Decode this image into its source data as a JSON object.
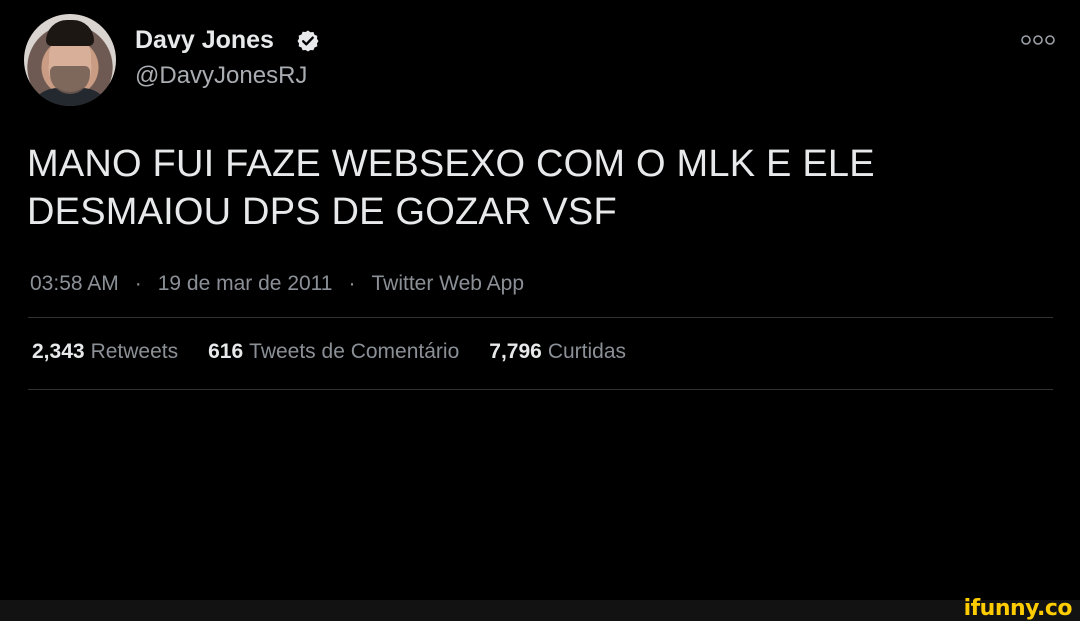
{
  "user": {
    "display_name": "Davy Jones",
    "handle": "@DavyJonesRJ",
    "verified": true
  },
  "tweet": {
    "text": "MANO FUI FAZE WEBSEXO COM O MLK E ELE DESMAIOU DPS DE GOZAR VSF",
    "time": "03:58 AM",
    "date": "19 de mar de 2011",
    "source": "Twitter Web App",
    "separator": "·"
  },
  "stats": {
    "retweets_count": "2,343",
    "retweets_label": "Retweets",
    "quotes_count": "616",
    "quotes_label": "Tweets de Comentário",
    "likes_count": "7,796",
    "likes_label": "Curtidas"
  },
  "watermark": {
    "text": "ifunny.co"
  },
  "icons": {
    "verified": "verified-badge-icon",
    "more": "more-options-icon"
  },
  "colors": {
    "background": "#000000",
    "text_primary": "#e7e9ea",
    "text_secondary": "#8b9096",
    "divider": "#2f3336",
    "watermark": "#ffcc00"
  }
}
